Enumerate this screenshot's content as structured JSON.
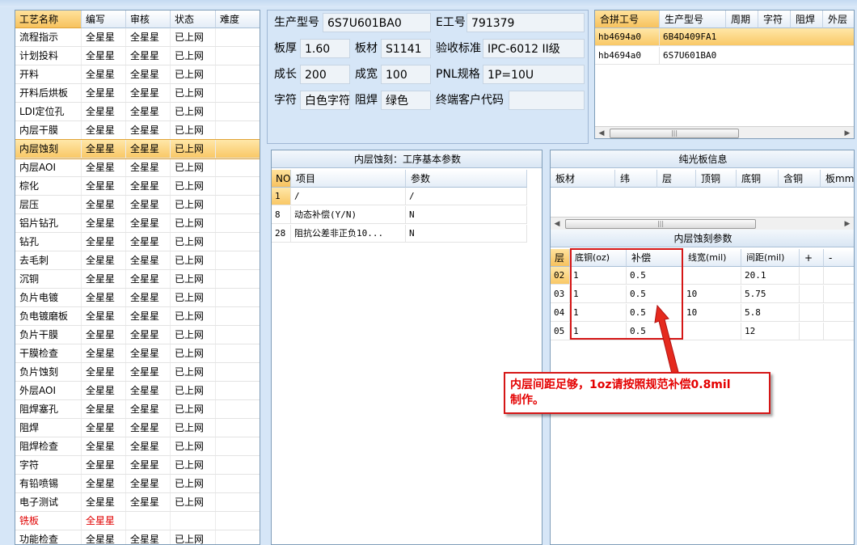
{
  "process_list": {
    "headers": [
      "工艺名称",
      "编写",
      "审核",
      "状态",
      "难度"
    ],
    "rows": [
      [
        "流程指示",
        "全星星",
        "全星星",
        "已上网",
        ""
      ],
      [
        "计划投料",
        "全星星",
        "全星星",
        "已上网",
        ""
      ],
      [
        "开料",
        "全星星",
        "全星星",
        "已上网",
        ""
      ],
      [
        "开料后烘板",
        "全星星",
        "全星星",
        "已上网",
        ""
      ],
      [
        "LDI定位孔",
        "全星星",
        "全星星",
        "已上网",
        ""
      ],
      [
        "内层干膜",
        "全星星",
        "全星星",
        "已上网",
        ""
      ],
      [
        "内层蚀刻",
        "全星星",
        "全星星",
        "已上网",
        ""
      ],
      [
        "内层AOI",
        "全星星",
        "全星星",
        "已上网",
        ""
      ],
      [
        "棕化",
        "全星星",
        "全星星",
        "已上网",
        ""
      ],
      [
        "层压",
        "全星星",
        "全星星",
        "已上网",
        ""
      ],
      [
        "铝片钻孔",
        "全星星",
        "全星星",
        "已上网",
        ""
      ],
      [
        "钻孔",
        "全星星",
        "全星星",
        "已上网",
        ""
      ],
      [
        "去毛刺",
        "全星星",
        "全星星",
        "已上网",
        ""
      ],
      [
        "沉铜",
        "全星星",
        "全星星",
        "已上网",
        ""
      ],
      [
        "负片电镀",
        "全星星",
        "全星星",
        "已上网",
        ""
      ],
      [
        "负电镀磨板",
        "全星星",
        "全星星",
        "已上网",
        ""
      ],
      [
        "负片干膜",
        "全星星",
        "全星星",
        "已上网",
        ""
      ],
      [
        "干膜检查",
        "全星星",
        "全星星",
        "已上网",
        ""
      ],
      [
        "负片蚀刻",
        "全星星",
        "全星星",
        "已上网",
        ""
      ],
      [
        "外层AOI",
        "全星星",
        "全星星",
        "已上网",
        ""
      ],
      [
        "阻焊塞孔",
        "全星星",
        "全星星",
        "已上网",
        ""
      ],
      [
        "阻焊",
        "全星星",
        "全星星",
        "已上网",
        ""
      ],
      [
        "阻焊检查",
        "全星星",
        "全星星",
        "已上网",
        ""
      ],
      [
        "字符",
        "全星星",
        "全星星",
        "已上网",
        ""
      ],
      [
        "有铅喷锡",
        "全星星",
        "全星星",
        "已上网",
        ""
      ],
      [
        "电子测试",
        "全星星",
        "全星星",
        "已上网",
        ""
      ],
      [
        "铣板",
        "全星星",
        "",
        "",
        ""
      ],
      [
        "功能检查",
        "全星星",
        "全星星",
        "已上网",
        ""
      ]
    ],
    "selected_index": 6,
    "red_index": 26
  },
  "info": {
    "prod_model_label": "生产型号",
    "prod_model": "6S7U601BA0",
    "e_no_label": "E工号",
    "e_no": "791379",
    "thickness_label": "板厚",
    "thickness": "1.60",
    "material_label": "板材",
    "material": "S1141",
    "standard_label": "验收标准",
    "standard": "IPC-6012 II级",
    "length_label": "成长",
    "length": "200",
    "width_label": "成宽",
    "width": "100",
    "pnl_label": "PNL规格",
    "pnl": "1P=10U",
    "silk_label": "字符",
    "silk": "白色字符",
    "mask_label": "阻焊",
    "mask": "绿色",
    "customer_label": "终端客户代码",
    "customer": ""
  },
  "combined_orders": {
    "headers": [
      "合拼工号",
      "生产型号",
      "周期",
      "字符",
      "阻焊",
      "外层"
    ],
    "rows": [
      [
        "hb4694a0",
        "6B4D409FA1"
      ],
      [
        "hb4694a0",
        "6S7U601BA0"
      ]
    ]
  },
  "params": {
    "title": "内层蚀刻：工序基本参数",
    "headers": [
      "NO",
      "项目",
      "参数"
    ],
    "rows": [
      [
        "1",
        "/",
        "/"
      ],
      [
        "8",
        "动态补偿(Y/N)",
        "N"
      ],
      [
        "28",
        "阻抗公差非正负10...",
        "N"
      ]
    ]
  },
  "bare_board": {
    "title": "纯光板信息",
    "headers": [
      "板材",
      "纬",
      "层",
      "顶铜",
      "底铜",
      "含铜",
      "板mm"
    ]
  },
  "etch_params": {
    "title": "内层蚀刻参数",
    "headers": [
      "层",
      "底铜(oz)",
      "补偿",
      "线宽(mil)",
      "间距(mil)",
      "+",
      "-"
    ],
    "rows": [
      [
        "02",
        "1",
        "0.5",
        "",
        "20.1"
      ],
      [
        "03",
        "1",
        "0.5",
        "10",
        "5.75"
      ],
      [
        "04",
        "1",
        "0.5",
        "10",
        "5.8"
      ],
      [
        "05",
        "1",
        "0.5",
        "",
        "12"
      ]
    ]
  },
  "annotation": {
    "text_line1": "内层间距足够，1oz请按照规范补偿0.8mil",
    "text_line2": "制作。",
    "color": "#d51616"
  },
  "icons": {
    "scroll_left": "◀",
    "scroll_right": "▶",
    "scroll_grip": "|||"
  }
}
